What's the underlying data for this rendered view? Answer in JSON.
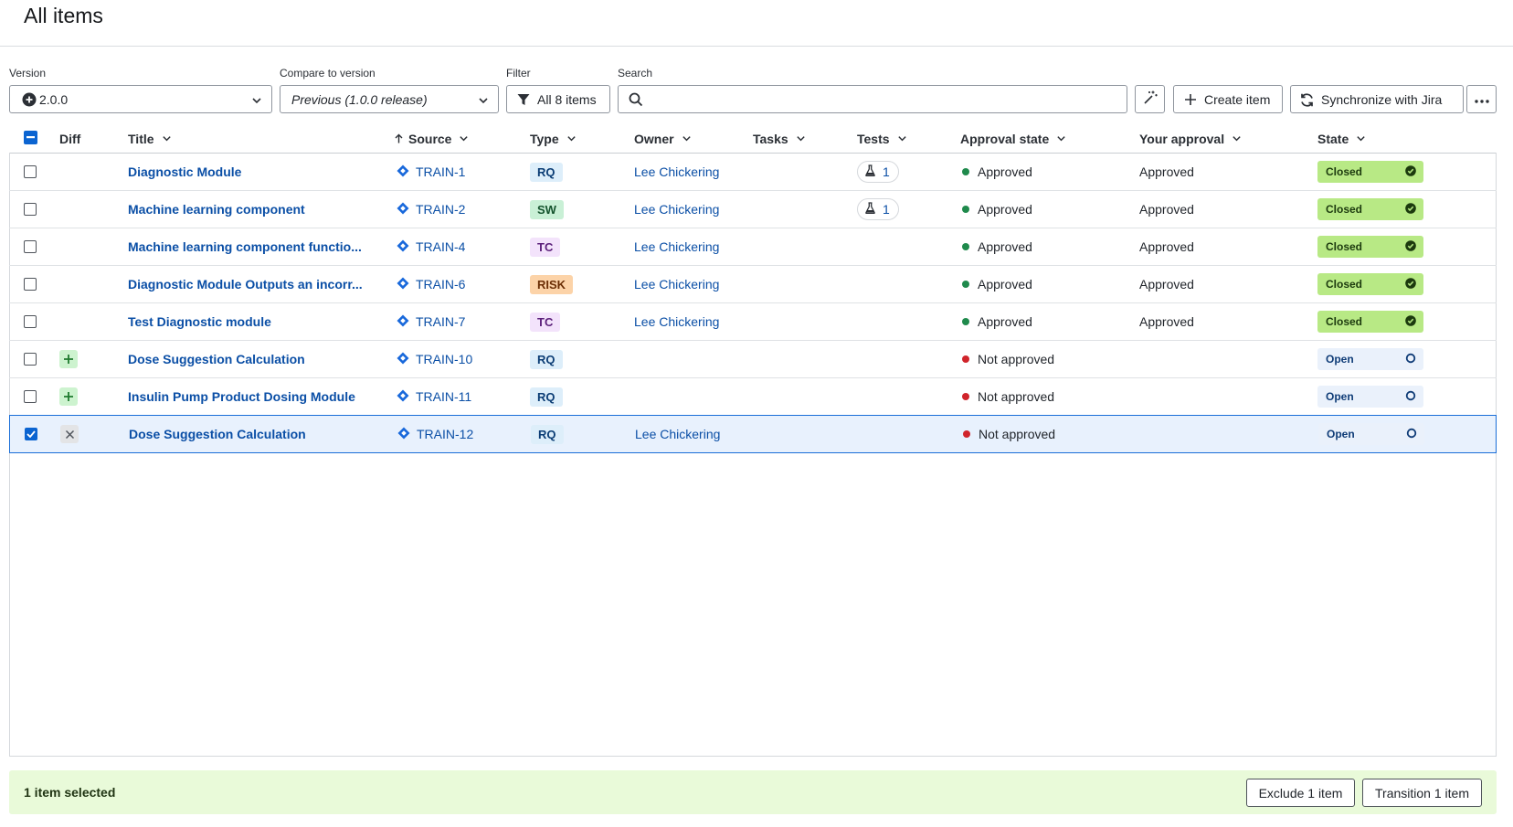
{
  "page": {
    "title": "All items"
  },
  "toolbar": {
    "version_label": "Version",
    "version_value": "2.0.0",
    "compare_label": "Compare to version",
    "compare_value": "Previous (1.0.0 release)",
    "filter_label": "Filter",
    "filter_value": "All 8 items",
    "search_label": "Search",
    "search_value": "",
    "search_placeholder": "",
    "create_label": "Create item",
    "sync_label": "Synchronize with Jira"
  },
  "table": {
    "columns": {
      "diff": "Diff",
      "title": "Title",
      "source": "Source",
      "type": "Type",
      "owner": "Owner",
      "tasks": "Tasks",
      "tests": "Tests",
      "approval_state": "Approval state",
      "your_approval": "Your approval",
      "state": "State"
    },
    "rows": [
      {
        "checked": false,
        "diff": "",
        "title": "Diagnostic Module",
        "source": "TRAIN-1",
        "type": "RQ",
        "owner": "Lee Chickering",
        "tests": "1",
        "approval_state": "Approved",
        "approval_color": "#1f8a4c",
        "your_approval": "Approved",
        "state": "Closed"
      },
      {
        "checked": false,
        "diff": "",
        "title": "Machine learning component",
        "source": "TRAIN-2",
        "type": "SW",
        "owner": "Lee Chickering",
        "tests": "1",
        "approval_state": "Approved",
        "approval_color": "#1f8a4c",
        "your_approval": "Approved",
        "state": "Closed"
      },
      {
        "checked": false,
        "diff": "",
        "title": "Machine learning component functio...",
        "source": "TRAIN-4",
        "type": "TC",
        "owner": "Lee Chickering",
        "tests": "",
        "approval_state": "Approved",
        "approval_color": "#1f8a4c",
        "your_approval": "Approved",
        "state": "Closed"
      },
      {
        "checked": false,
        "diff": "",
        "title": "Diagnostic Module Outputs an incorr...",
        "source": "TRAIN-6",
        "type": "RISK",
        "owner": "Lee Chickering",
        "tests": "",
        "approval_state": "Approved",
        "approval_color": "#1f8a4c",
        "your_approval": "Approved",
        "state": "Closed"
      },
      {
        "checked": false,
        "diff": "",
        "title": "Test Diagnostic module",
        "source": "TRAIN-7",
        "type": "TC",
        "owner": "Lee Chickering",
        "tests": "",
        "approval_state": "Approved",
        "approval_color": "#1f8a4c",
        "your_approval": "Approved",
        "state": "Closed"
      },
      {
        "checked": false,
        "diff": "added",
        "title": "Dose Suggestion Calculation",
        "source": "TRAIN-10",
        "type": "RQ",
        "owner": "",
        "tests": "",
        "approval_state": "Not approved",
        "approval_color": "#d0242b",
        "your_approval": "",
        "state": "Open"
      },
      {
        "checked": false,
        "diff": "added",
        "title": "Insulin Pump Product Dosing Module",
        "source": "TRAIN-11",
        "type": "RQ",
        "owner": "",
        "tests": "",
        "approval_state": "Not approved",
        "approval_color": "#d0242b",
        "your_approval": "",
        "state": "Open"
      },
      {
        "checked": true,
        "diff": "removed",
        "title": "Dose Suggestion Calculation",
        "source": "TRAIN-12",
        "type": "RQ",
        "owner": "Lee Chickering",
        "tests": "",
        "approval_state": "Not approved",
        "approval_color": "#d0242b",
        "your_approval": "",
        "state": "Open"
      }
    ]
  },
  "type_colors": {
    "RQ": {
      "bg": "#ddeefa",
      "fg": "#0b3d75"
    },
    "SW": {
      "bg": "#c9f0d6",
      "fg": "#14532d"
    },
    "TC": {
      "bg": "#f3e3fb",
      "fg": "#5b1f7a"
    },
    "RISK": {
      "bg": "#fcd3a8",
      "fg": "#6b2e05"
    }
  },
  "icons": {
    "version": "plus-circle-icon",
    "filter": "funnel-icon",
    "search": "search-icon",
    "magic": "magic-wand-icon",
    "create": "plus-icon",
    "sync": "sync-icon",
    "more": "more-icon",
    "source": "jira-diamond-icon",
    "tests": "flask-icon",
    "closed": "check-circle-icon",
    "open": "open-circle-icon"
  },
  "selection": {
    "text": "1 item selected",
    "exclude_label": "Exclude 1 item",
    "transition_label": "Transition 1 item"
  }
}
